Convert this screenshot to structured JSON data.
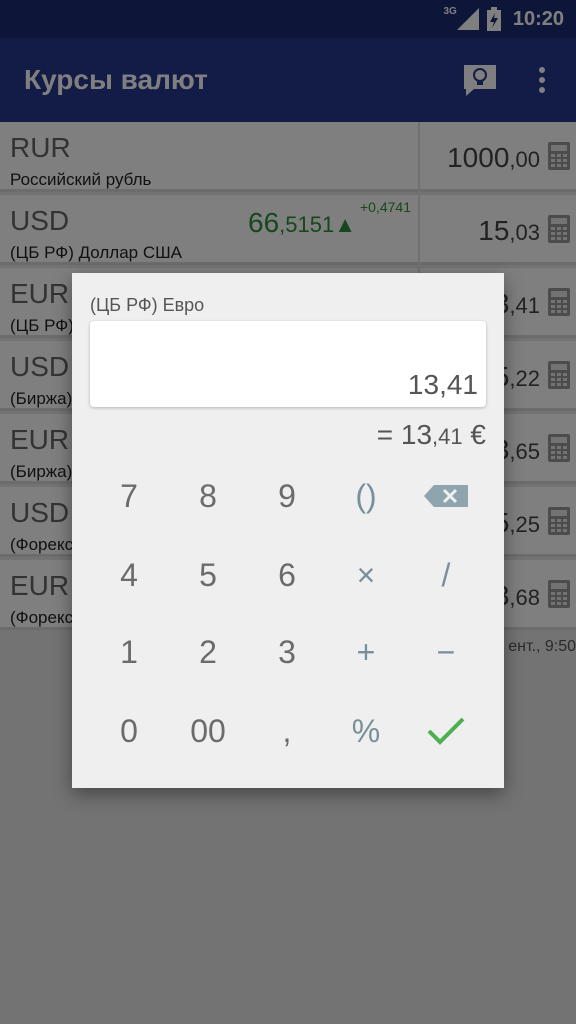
{
  "status_bar": {
    "network": "3G",
    "time": "10:20"
  },
  "app_bar": {
    "title": "Курсы валют"
  },
  "rows": [
    {
      "code": "RUR",
      "name": "Российский рубль",
      "amount_int": "1000",
      "amount_dec": ",00",
      "rate_int": "",
      "rate_dec": "",
      "delta": ""
    },
    {
      "code": "USD",
      "name": "(ЦБ РФ) Доллар США",
      "amount_int": "15",
      "amount_dec": ",03",
      "rate_int": "66",
      "rate_dec": ",5151▲",
      "delta": "+0,4741"
    },
    {
      "code": "EUR",
      "name": "(ЦБ РФ)",
      "amount_int": "13",
      "amount_dec": ",41",
      "rate_int": "",
      "rate_dec": "",
      "delta": ""
    },
    {
      "code": "USD",
      "name": "(Биржа)",
      "amount_int": "15",
      "amount_dec": ",22",
      "rate_int": "",
      "rate_dec": "",
      "delta": ""
    },
    {
      "code": "EUR",
      "name": "(Биржа)",
      "amount_int": "13",
      "amount_dec": ",65",
      "rate_int": "",
      "rate_dec": "",
      "delta": ""
    },
    {
      "code": "USD",
      "name": "(Форекс",
      "amount_int": "15",
      "amount_dec": ",25",
      "rate_int": "",
      "rate_dec": "",
      "delta": ""
    },
    {
      "code": "EUR",
      "name": "(Форекс",
      "amount_int": "13",
      "amount_dec": ",68",
      "rate_int": "",
      "rate_dec": "",
      "delta": ""
    }
  ],
  "updated_text": "ент., 9:50",
  "dialog": {
    "title": "(ЦБ РФ) Евро",
    "input_value": "13,41",
    "result_prefix": "= 13",
    "result_dec": ",41",
    "result_suffix": " €"
  },
  "keypad": {
    "k7": "7",
    "k8": "8",
    "k9": "9",
    "paren": "()",
    "k4": "4",
    "k5": "5",
    "k6": "6",
    "mul": "×",
    "div": "/",
    "k1": "1",
    "k2": "2",
    "k3": "3",
    "plus": "+",
    "minus": "−",
    "k0": "0",
    "k00": "00",
    "comma": ",",
    "percent": "%"
  },
  "colors": {
    "app_bar": "#26378f",
    "status_bar": "#1a2b73",
    "positive": "#2f8f38",
    "operator": "#78909c",
    "confirm": "#4caf50"
  }
}
